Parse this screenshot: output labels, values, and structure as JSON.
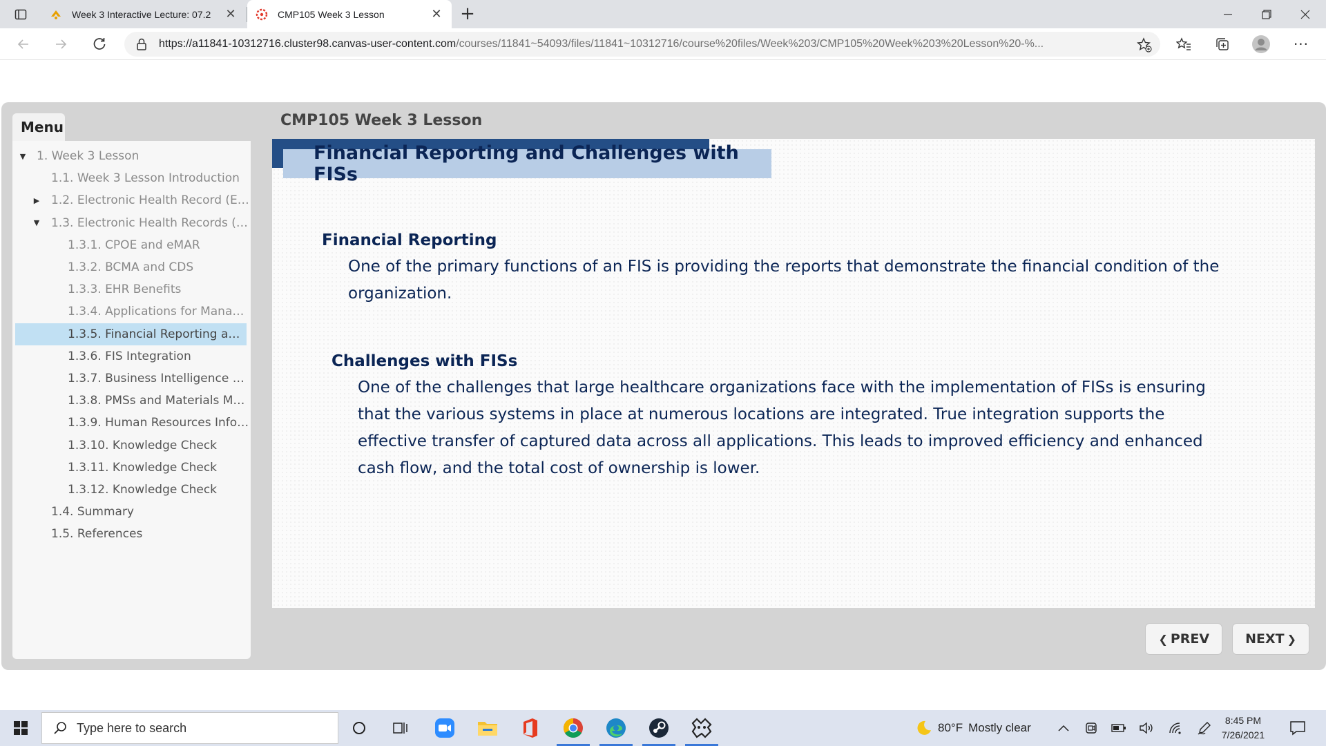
{
  "browser": {
    "tabs": [
      {
        "title": "Week 3 Interactive Lecture: 07.2",
        "active": false
      },
      {
        "title": "CMP105 Week 3 Lesson",
        "active": true
      }
    ],
    "address": {
      "host": "https://a11841-10312716.cluster98.canvas-user-content.com",
      "path": "/courses/11841~54093/files/11841~10312716/course%20files/Week%203/CMP105%20Week%203%20Lesson%20-%..."
    }
  },
  "course": {
    "header_title": "CMP105 Week 3 Lesson",
    "menu_label": "Menu",
    "menu": [
      {
        "label": "1. Week 3 Lesson",
        "level": 1,
        "caret": "down",
        "state": "normal"
      },
      {
        "label": "1.1. Week 3 Lesson Introduction",
        "level": 2,
        "caret": "",
        "state": "normal"
      },
      {
        "label": "1.2. Electronic Health Record (EH...",
        "level": 2,
        "caret": "right",
        "state": "normal"
      },
      {
        "label": "1.3. Electronic Health Records (E...",
        "level": 2,
        "caret": "down",
        "state": "normal"
      },
      {
        "label": "1.3.1. CPOE and eMAR",
        "level": 3,
        "caret": "",
        "state": "normal"
      },
      {
        "label": "1.3.2. BCMA and CDS",
        "level": 3,
        "caret": "",
        "state": "normal"
      },
      {
        "label": "1.3.3. EHR Benefits",
        "level": 3,
        "caret": "",
        "state": "normal"
      },
      {
        "label": "1.3.4. Applications for Managi...",
        "level": 3,
        "caret": "",
        "state": "normal"
      },
      {
        "label": "1.3.5. Financial Reporting and ...",
        "level": 3,
        "caret": "",
        "state": "current"
      },
      {
        "label": "1.3.6. FIS Integration",
        "level": 3,
        "caret": "",
        "state": "visited"
      },
      {
        "label": "1.3.7. Business Intelligence Sy...",
        "level": 3,
        "caret": "",
        "state": "visited"
      },
      {
        "label": "1.3.8. PMSs and Materials Ma...",
        "level": 3,
        "caret": "",
        "state": "visited"
      },
      {
        "label": "1.3.9. Human Resources Infor...",
        "level": 3,
        "caret": "",
        "state": "visited"
      },
      {
        "label": "1.3.10. Knowledge Check",
        "level": 3,
        "caret": "",
        "state": "visited"
      },
      {
        "label": "1.3.11. Knowledge Check",
        "level": 3,
        "caret": "",
        "state": "visited"
      },
      {
        "label": "1.3.12. Knowledge Check",
        "level": 3,
        "caret": "",
        "state": "visited"
      },
      {
        "label": "1.4. Summary",
        "level": 2,
        "caret": "",
        "state": "visited"
      },
      {
        "label": "1.5. References",
        "level": 2,
        "caret": "",
        "state": "visited"
      }
    ],
    "slide": {
      "title": "Financial Reporting and Challenges with FISs",
      "section1_heading": "Financial Reporting",
      "section1_body": "One of the primary functions of an FIS is providing the reports that demonstrate the financial condition of the organization.",
      "section2_heading": "Challenges with FISs",
      "section2_body": "One of the challenges that large healthcare organizations face with the implementation of FISs is ensuring that the various systems in place at numerous locations are integrated. True integration supports the effective transfer of captured data across all applications. This leads to improved efficiency and enhanced cash flow, and the total cost of ownership is lower."
    },
    "nav": {
      "prev": "PREV",
      "next": "NEXT"
    }
  },
  "taskbar": {
    "search_placeholder": "Type here to search",
    "weather_temp": "80°F",
    "weather_text": "Mostly clear",
    "time": "8:45 PM",
    "date": "7/26/2021"
  },
  "colors": {
    "slide_title_text": "#0b2555",
    "title_bar_dark": "#244e86",
    "title_bar_light": "#b8cde6",
    "menu_current": "#c1e0f3"
  }
}
